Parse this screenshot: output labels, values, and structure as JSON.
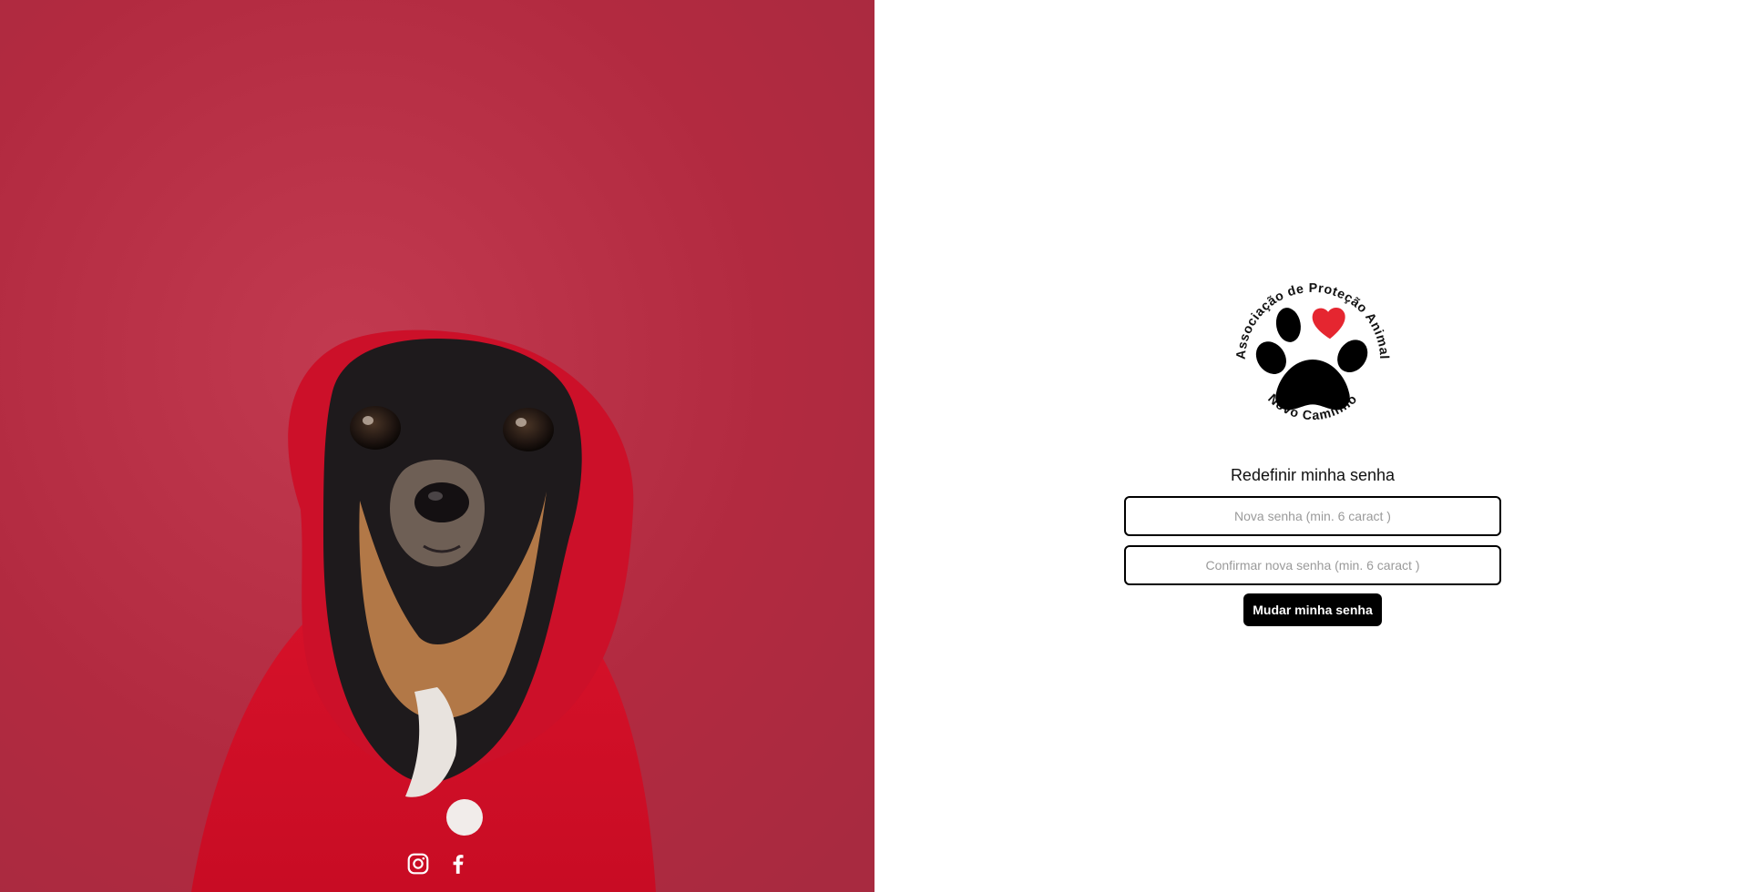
{
  "hero": {
    "image_subject": "dog-in-red-hoodie",
    "background_color": "#b22a40",
    "social": [
      {
        "name": "instagram-icon"
      },
      {
        "name": "facebook-icon"
      }
    ]
  },
  "form": {
    "logo": {
      "top_arc_text": "Associação de Proteção Animal",
      "bottom_arc_text": "Novo Caminho",
      "heart_color": "#e52630"
    },
    "title": "Redefinir minha senha",
    "new_password": {
      "value": "",
      "placeholder": "Nova senha (min. 6 caract )"
    },
    "confirm_password": {
      "value": "",
      "placeholder": "Confirmar nova senha (min. 6 caract )"
    },
    "submit_label": "Mudar minha senha"
  }
}
